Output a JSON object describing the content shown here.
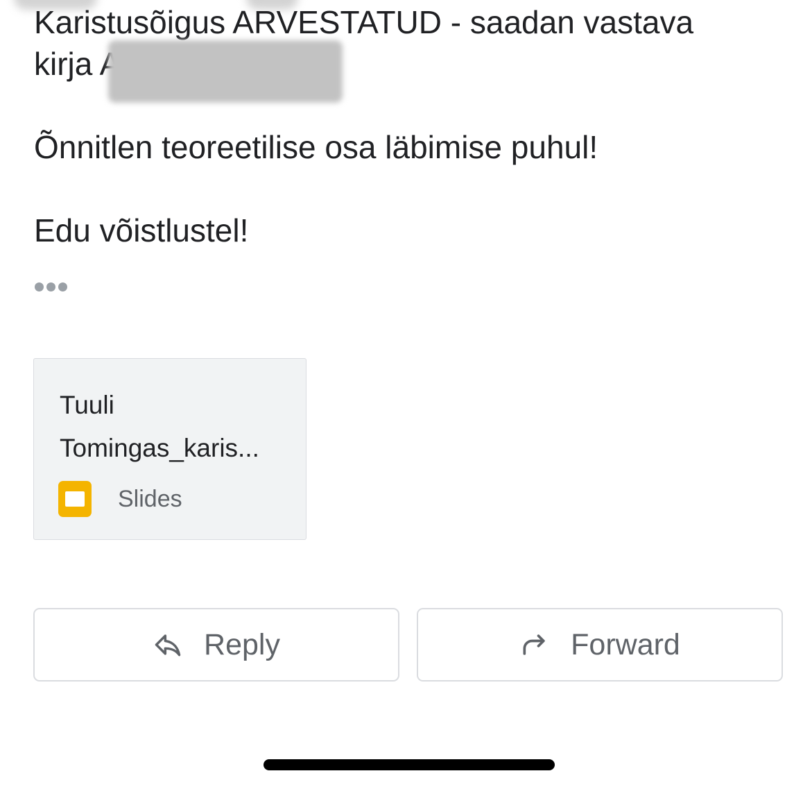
{
  "email_body": {
    "line1": "Karistusõigus ARVESTATUD - saadan vastava",
    "line2": "kirja A",
    "line3": "Õnnitlen teoreetilise osa läbimise puhul!",
    "line4": "Edu võistlustel!"
  },
  "attachment": {
    "name_line1": "Tuuli",
    "name_line2": "Tomingas_karis...",
    "type_label": "Slides",
    "icon": "google-slides-icon",
    "icon_color": "#F4B400"
  },
  "actions": {
    "reply_label": "Reply",
    "reply_icon": "reply-arrow-icon",
    "forward_label": "Forward",
    "forward_icon": "forward-arrow-icon"
  },
  "colors": {
    "text": "#202124",
    "secondary_text": "#5F6368",
    "border": "#DADCE0",
    "attachment_bg": "#F1F3F4"
  }
}
